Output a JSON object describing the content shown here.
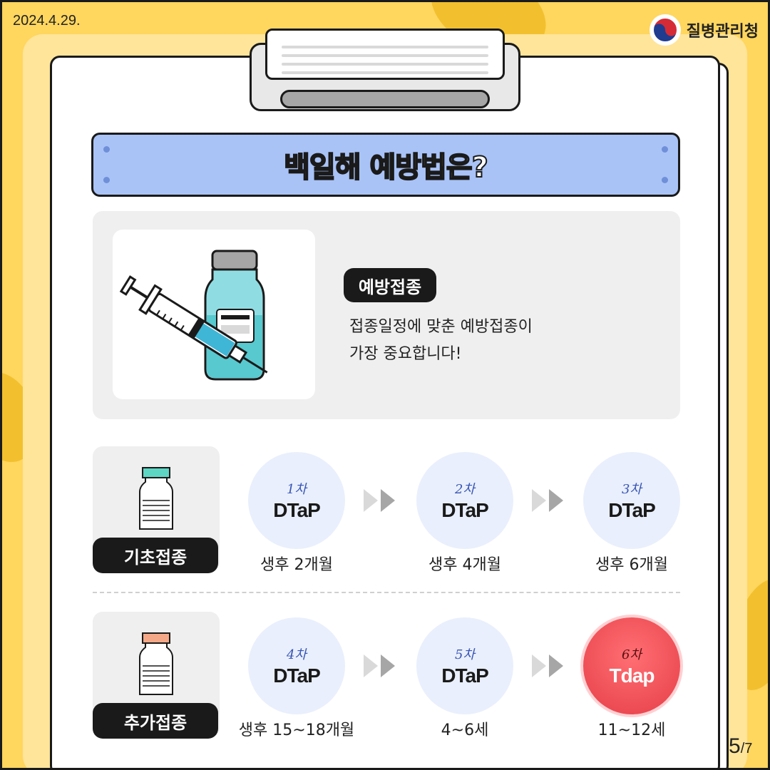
{
  "header": {
    "date": "2024.4.29.",
    "org_name": "질병관리청"
  },
  "title": {
    "part1": "백일해 ",
    "highlight": "예방법",
    "part2": "은?"
  },
  "intro": {
    "badge": "예방접종",
    "line1": "접종일정에 맞춘 예방접종이",
    "line2": "가장 중요합니다!"
  },
  "primary": {
    "label": "기초접종",
    "cap_color": "#5ed6c4",
    "doses": [
      {
        "dose": "1차",
        "vaccine": "DTaP",
        "age": "생후 2개월"
      },
      {
        "dose": "2차",
        "vaccine": "DTaP",
        "age": "생후 4개월"
      },
      {
        "dose": "3차",
        "vaccine": "DTaP",
        "age": "생후 6개월"
      }
    ]
  },
  "booster": {
    "label": "추가접종",
    "cap_color": "#f5a887",
    "doses": [
      {
        "dose": "4차",
        "vaccine": "DTaP",
        "age": "생후 15~18개월"
      },
      {
        "dose": "5차",
        "vaccine": "DTaP",
        "age": "4~6세"
      },
      {
        "dose": "6차",
        "vaccine": "Tdap",
        "age": "11~12세"
      }
    ]
  },
  "pager": {
    "current": "5",
    "total": "/7"
  },
  "colors": {
    "background": "#ffd65e",
    "title_box": "#a9c3f7",
    "circle": "#e9effc",
    "highlight_circle": "#e63e48"
  }
}
